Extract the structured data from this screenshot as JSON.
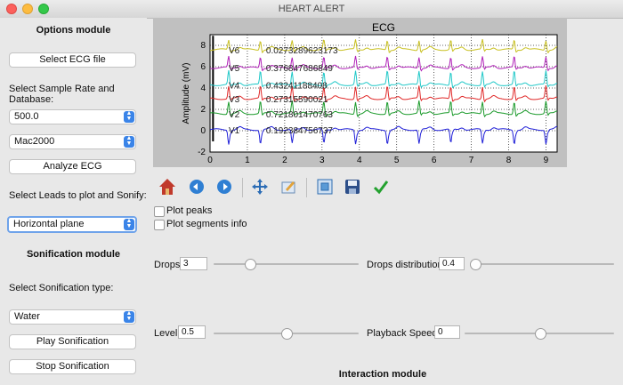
{
  "window": {
    "title": "HEART ALERT"
  },
  "sidebar": {
    "options_heading": "Options module",
    "select_ecg_button": "Select ECG file",
    "sample_rate_label": "Select Sample Rate and Database:",
    "sample_rate_value": "500.0",
    "database_value": "Mac2000",
    "analyze_button": "Analyze ECG",
    "leads_label": "Select Leads to plot and Sonify:",
    "leads_value": "Horizontal plane",
    "sonification_heading": "Sonification module",
    "sonification_type_label": "Select Sonification type:",
    "sonification_type_value": "Water",
    "play_button": "Play Sonification",
    "stop_button": "Stop Sonification"
  },
  "chart_data": {
    "type": "line",
    "title": "ECG",
    "xlabel": "",
    "ylabel": "Amplitude (mV)",
    "xlim": [
      0,
      9.3
    ],
    "ylim": [
      -2,
      9
    ],
    "x_ticks": [
      "0",
      "1",
      "2",
      "3",
      "4",
      "5",
      "6",
      "7",
      "8",
      "9"
    ],
    "y_ticks": [
      "-2",
      "0",
      "2",
      "4",
      "6",
      "8"
    ],
    "grid": true,
    "beats_x": [
      0.5,
      1.35,
      2.2,
      3.05,
      3.9,
      4.75,
      5.6,
      6.45,
      7.3,
      8.15,
      9.0
    ],
    "series": [
      {
        "name": "V1",
        "value_label": "0.192384756737",
        "baseline": 0.1,
        "color": "#2020d8"
      },
      {
        "name": "V2",
        "value_label": "0.721801470763",
        "baseline": 1.6,
        "color": "#1a9a2a"
      },
      {
        "name": "V3",
        "value_label": "0.27315590021",
        "baseline": 3.0,
        "color": "#e02828"
      },
      {
        "name": "V4",
        "value_label": "0.43241188408",
        "baseline": 4.3,
        "color": "#20c8c8"
      },
      {
        "name": "V5",
        "value_label": "0.376847686849",
        "baseline": 5.9,
        "color": "#b020b8"
      },
      {
        "name": "V6",
        "value_label": "0.0273289623173",
        "baseline": 7.6,
        "color": "#c8c020"
      }
    ]
  },
  "toolbar": {
    "icons": [
      "home-icon",
      "back-arrow-icon",
      "forward-arrow-icon",
      "pan-move-icon",
      "zoom-edit-icon",
      "configure-subplots-icon",
      "save-icon",
      "checkmark-icon"
    ]
  },
  "options": {
    "plot_peaks_label": "Plot peaks",
    "plot_segments_label": "Plot segments info"
  },
  "controls": {
    "drops_label": "Drops:",
    "drops_value": "3",
    "drops_slider_fraction": 0.25,
    "drops_distribution_label": "Drops distribution:",
    "drops_distribution_value": "0.4",
    "drops_distribution_slider_fraction": 0.03,
    "level_label": "Level:",
    "level_value": "0.5",
    "level_slider_fraction": 0.5,
    "playback_speed_label": "Playback Speed:",
    "playback_speed_value": "0",
    "playback_speed_slider_fraction": 0.5
  },
  "interaction": {
    "heading": "Interaction module"
  },
  "colors": {
    "accent": "#3a84e8",
    "plot_bg": "#c0c0c0"
  }
}
